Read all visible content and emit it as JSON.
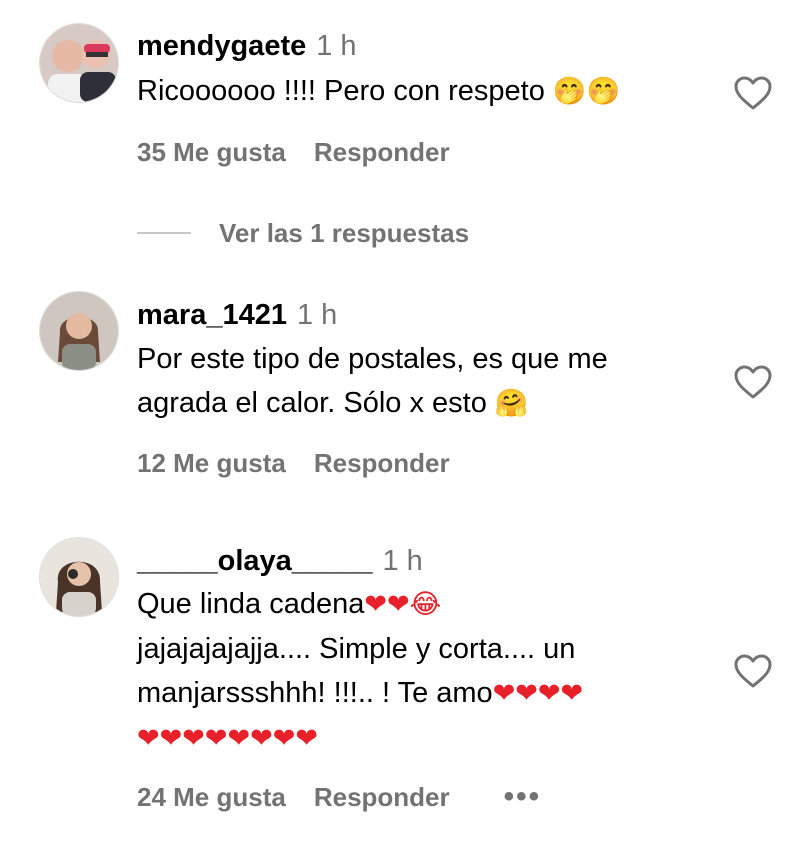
{
  "comments": [
    {
      "username": "mendygaete",
      "time": "1 h",
      "lines": [
        "Ricoooooo !!!! Pero con respeto "
      ],
      "emoji_line_0": "🤭🤭",
      "likes": "35 Me gusta",
      "reply": "Responder",
      "replies_link": "Ver las 1 respuestas"
    },
    {
      "username": "mara_1421",
      "time": "1 h",
      "line1": "Por este tipo de postales, es que me",
      "line2": "agrada el calor. Sólo x esto ",
      "emoji_line2": "🤗",
      "likes": "12 Me gusta",
      "reply": "Responder"
    },
    {
      "username": "_____olaya_____",
      "time": "1 h",
      "line1": "Que linda cadena",
      "line1_emoji": "❤❤😂",
      "line2": "jajajajajajja.... Simple y corta.... un",
      "line3": "manjarssshhh! !!!.. ! Te amo",
      "line3_emoji": "❤❤❤❤",
      "line4_emoji": "❤❤❤❤❤❤❤❤",
      "likes": "24 Me gusta",
      "reply": "Responder",
      "more": "•••"
    }
  ],
  "icons": {
    "like": "heart-outline-icon",
    "more": "more-options-icon"
  },
  "colors": {
    "text": "#000000",
    "secondary": "#737373",
    "heart": "#e8202a"
  }
}
